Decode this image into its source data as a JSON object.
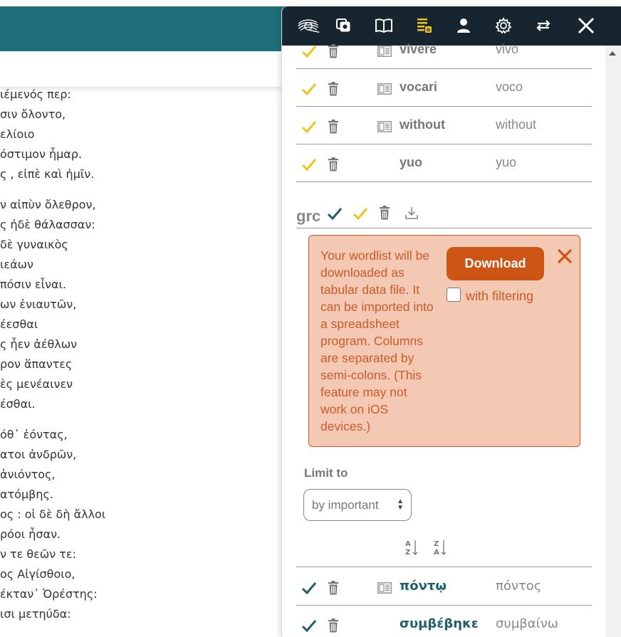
{
  "greek_lines": [
    "ιέμενός περ:",
    "σιν ὄλοντο,",
    "ελίοιο",
    "όστιμον ἦμαρ.",
    "ς , εἰπὲ καὶ ἡμῖν.",
    "",
    "ν αἰπὺν ὄλεθρον,",
    "ς ἠδὲ θάλασσαν:",
    "δὲ γυναικὸς",
    "ιεάων",
    "πόσιν εἶναι.",
    "ων ἐνιαυτῶν,",
    "έεσθαι",
    "ς ἦεν ἀέθλων",
    "ρον ἅπαντες",
    "ὲς μενέαινεν",
    "έσθαι.",
    "",
    "όθ᾿ ἐόντας,",
    "ατοι ἀνδρῶν,",
    "ἀνιόντος,",
    "ατόμβης.",
    "ος : οἱ δὲ δὴ ἄλλοι",
    "ρόοι ἦσαν.",
    "ν τε θεῶν τε:",
    "ος Αἰγίσθοιο,",
    "έκταν᾿ Ὀρέστης:",
    "ισι μετηύδα:"
  ],
  "toolbar": {
    "icons": [
      "logo-icon",
      "flashcards-icon",
      "book-icon",
      "wordlist-icon",
      "user-icon",
      "gear-icon",
      "swap-icon",
      "close-icon"
    ],
    "active_color": "#f0c419"
  },
  "latin_words": [
    {
      "word": "vivere",
      "lemma": "vivo",
      "has_book": true
    },
    {
      "word": "vocari",
      "lemma": "voco",
      "has_book": true
    },
    {
      "word": "without",
      "lemma": "without",
      "has_book": true
    },
    {
      "word": "yuo",
      "lemma": "yuo",
      "has_book": false
    }
  ],
  "language": {
    "code": "grc"
  },
  "download_box": {
    "text": "Your wordlist will be downloaded as tabular data file. It can be imported into a spreadsheet program. Columns are separated by semi-colons. (This feature may not work on iOS devices.)",
    "button_label": "Download",
    "checkbox_label": "with filtering",
    "checkbox_checked": false
  },
  "limit": {
    "label": "Limit to",
    "selected": "by important"
  },
  "greek_words": [
    {
      "word": "πόντῳ",
      "lemma": "πόντος",
      "has_book": true
    },
    {
      "word": "συμβέβηκε",
      "lemma": "συμβαίνω",
      "has_book": false
    }
  ],
  "colors": {
    "teal": "#1e6f7a",
    "dark": "#16252f",
    "yellow_check": "#f0c419",
    "teal_check": "#1e5f6b",
    "orange": "#cc5516",
    "download_bg": "#f3c9b3"
  }
}
